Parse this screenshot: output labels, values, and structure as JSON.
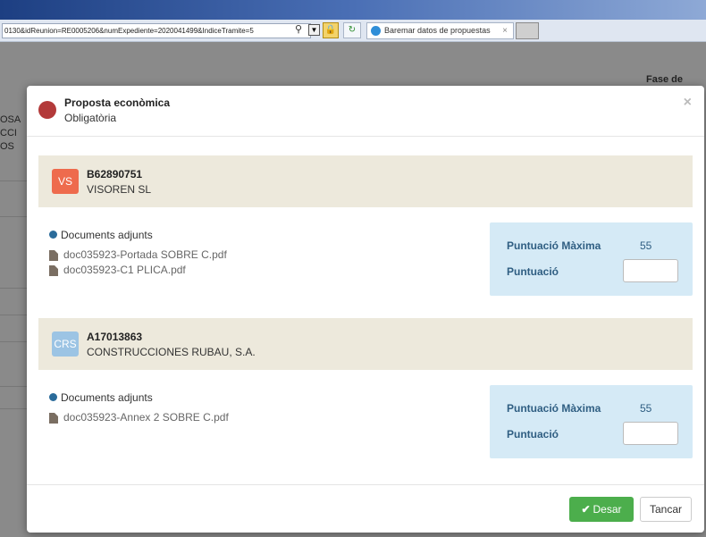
{
  "browser": {
    "url": "0130&idReunion=RE0005206&numExpediente=2020041499&IndiceTramite=5",
    "tab_title": "Baremar datos de propuestas",
    "tab_close": "×"
  },
  "background": {
    "header_right": "Fase de",
    "left_text": [
      "OSA",
      "CCI",
      "OS"
    ]
  },
  "modal": {
    "title": "Proposta econòmica",
    "subtitle": "Obligatòria",
    "close": "×",
    "companies": [
      {
        "initials": "VS",
        "avatar_color": "#ee6b4d",
        "id": "B62890751",
        "name": "VISOREN SL",
        "docs_label": "Documents adjunts",
        "files": [
          "doc035923-Portada SOBRE C.pdf",
          "doc035923-C1 PLICA.pdf"
        ],
        "max_label": "Puntuació Màxima",
        "max_value": "55",
        "score_label": "Puntuació",
        "score_value": ""
      },
      {
        "initials": "CRS",
        "avatar_color": "#9cc4e4",
        "id": "A17013863",
        "name": "CONSTRUCCIONES RUBAU, S.A.",
        "docs_label": "Documents adjunts",
        "files": [
          "doc035923-Annex 2 SOBRE C.pdf"
        ],
        "max_label": "Puntuació Màxima",
        "max_value": "55",
        "score_label": "Puntuació",
        "score_value": ""
      }
    ],
    "save_label": "Desar",
    "cancel_label": "Tancar"
  }
}
